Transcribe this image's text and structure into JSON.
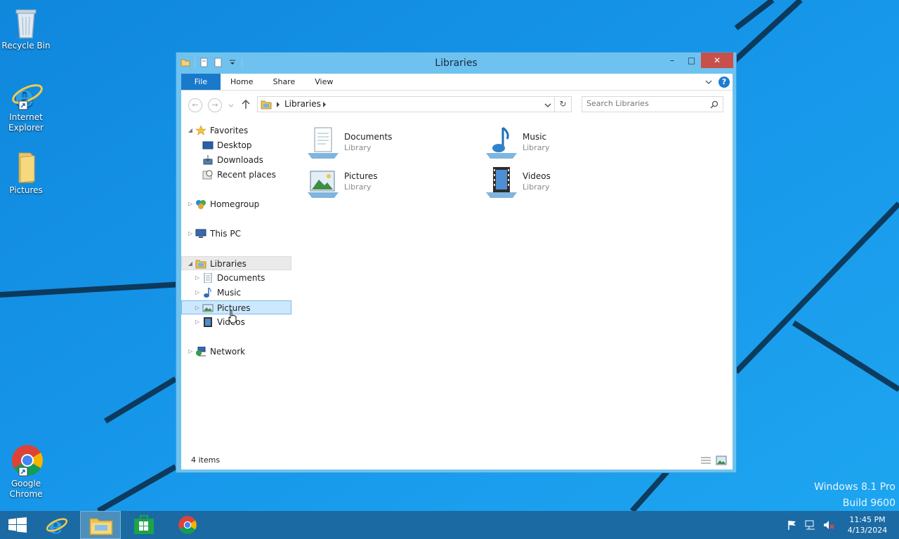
{
  "desktop": {
    "icons": [
      {
        "label": "Recycle Bin"
      },
      {
        "label": "Internet Explorer"
      },
      {
        "label": "Pictures"
      },
      {
        "label": "Google Chrome"
      }
    ],
    "watermark": {
      "line1": "Windows 8.1 Pro",
      "line2": "Build 9600"
    }
  },
  "window": {
    "title": "Libraries",
    "ribbon_tabs": [
      "File",
      "Home",
      "Share",
      "View"
    ],
    "address": {
      "breadcrumb": "Libraries"
    },
    "search": {
      "placeholder": "Search Libraries"
    },
    "nav": {
      "favorites": "Favorites",
      "desktop": "Desktop",
      "downloads": "Downloads",
      "recent": "Recent places",
      "homegroup": "Homegroup",
      "thispc": "This PC",
      "libraries": "Libraries",
      "documents": "Documents",
      "music": "Music",
      "pictures": "Pictures",
      "videos": "Videos",
      "network": "Network"
    },
    "files": [
      {
        "name": "Documents",
        "type": "Library"
      },
      {
        "name": "Music",
        "type": "Library"
      },
      {
        "name": "Pictures",
        "type": "Library"
      },
      {
        "name": "Videos",
        "type": "Library"
      }
    ],
    "status": "4 items"
  },
  "taskbar": {
    "time": "11:45 PM",
    "date": "4/13/2024"
  },
  "colors": {
    "desktop_bg": "#1592e6",
    "window_frame": "#6ec2f0",
    "file_tab": "#1979ca",
    "close_button": "#c7504b",
    "taskbar": "#1b6aa3",
    "selection": "#cce8ff"
  }
}
